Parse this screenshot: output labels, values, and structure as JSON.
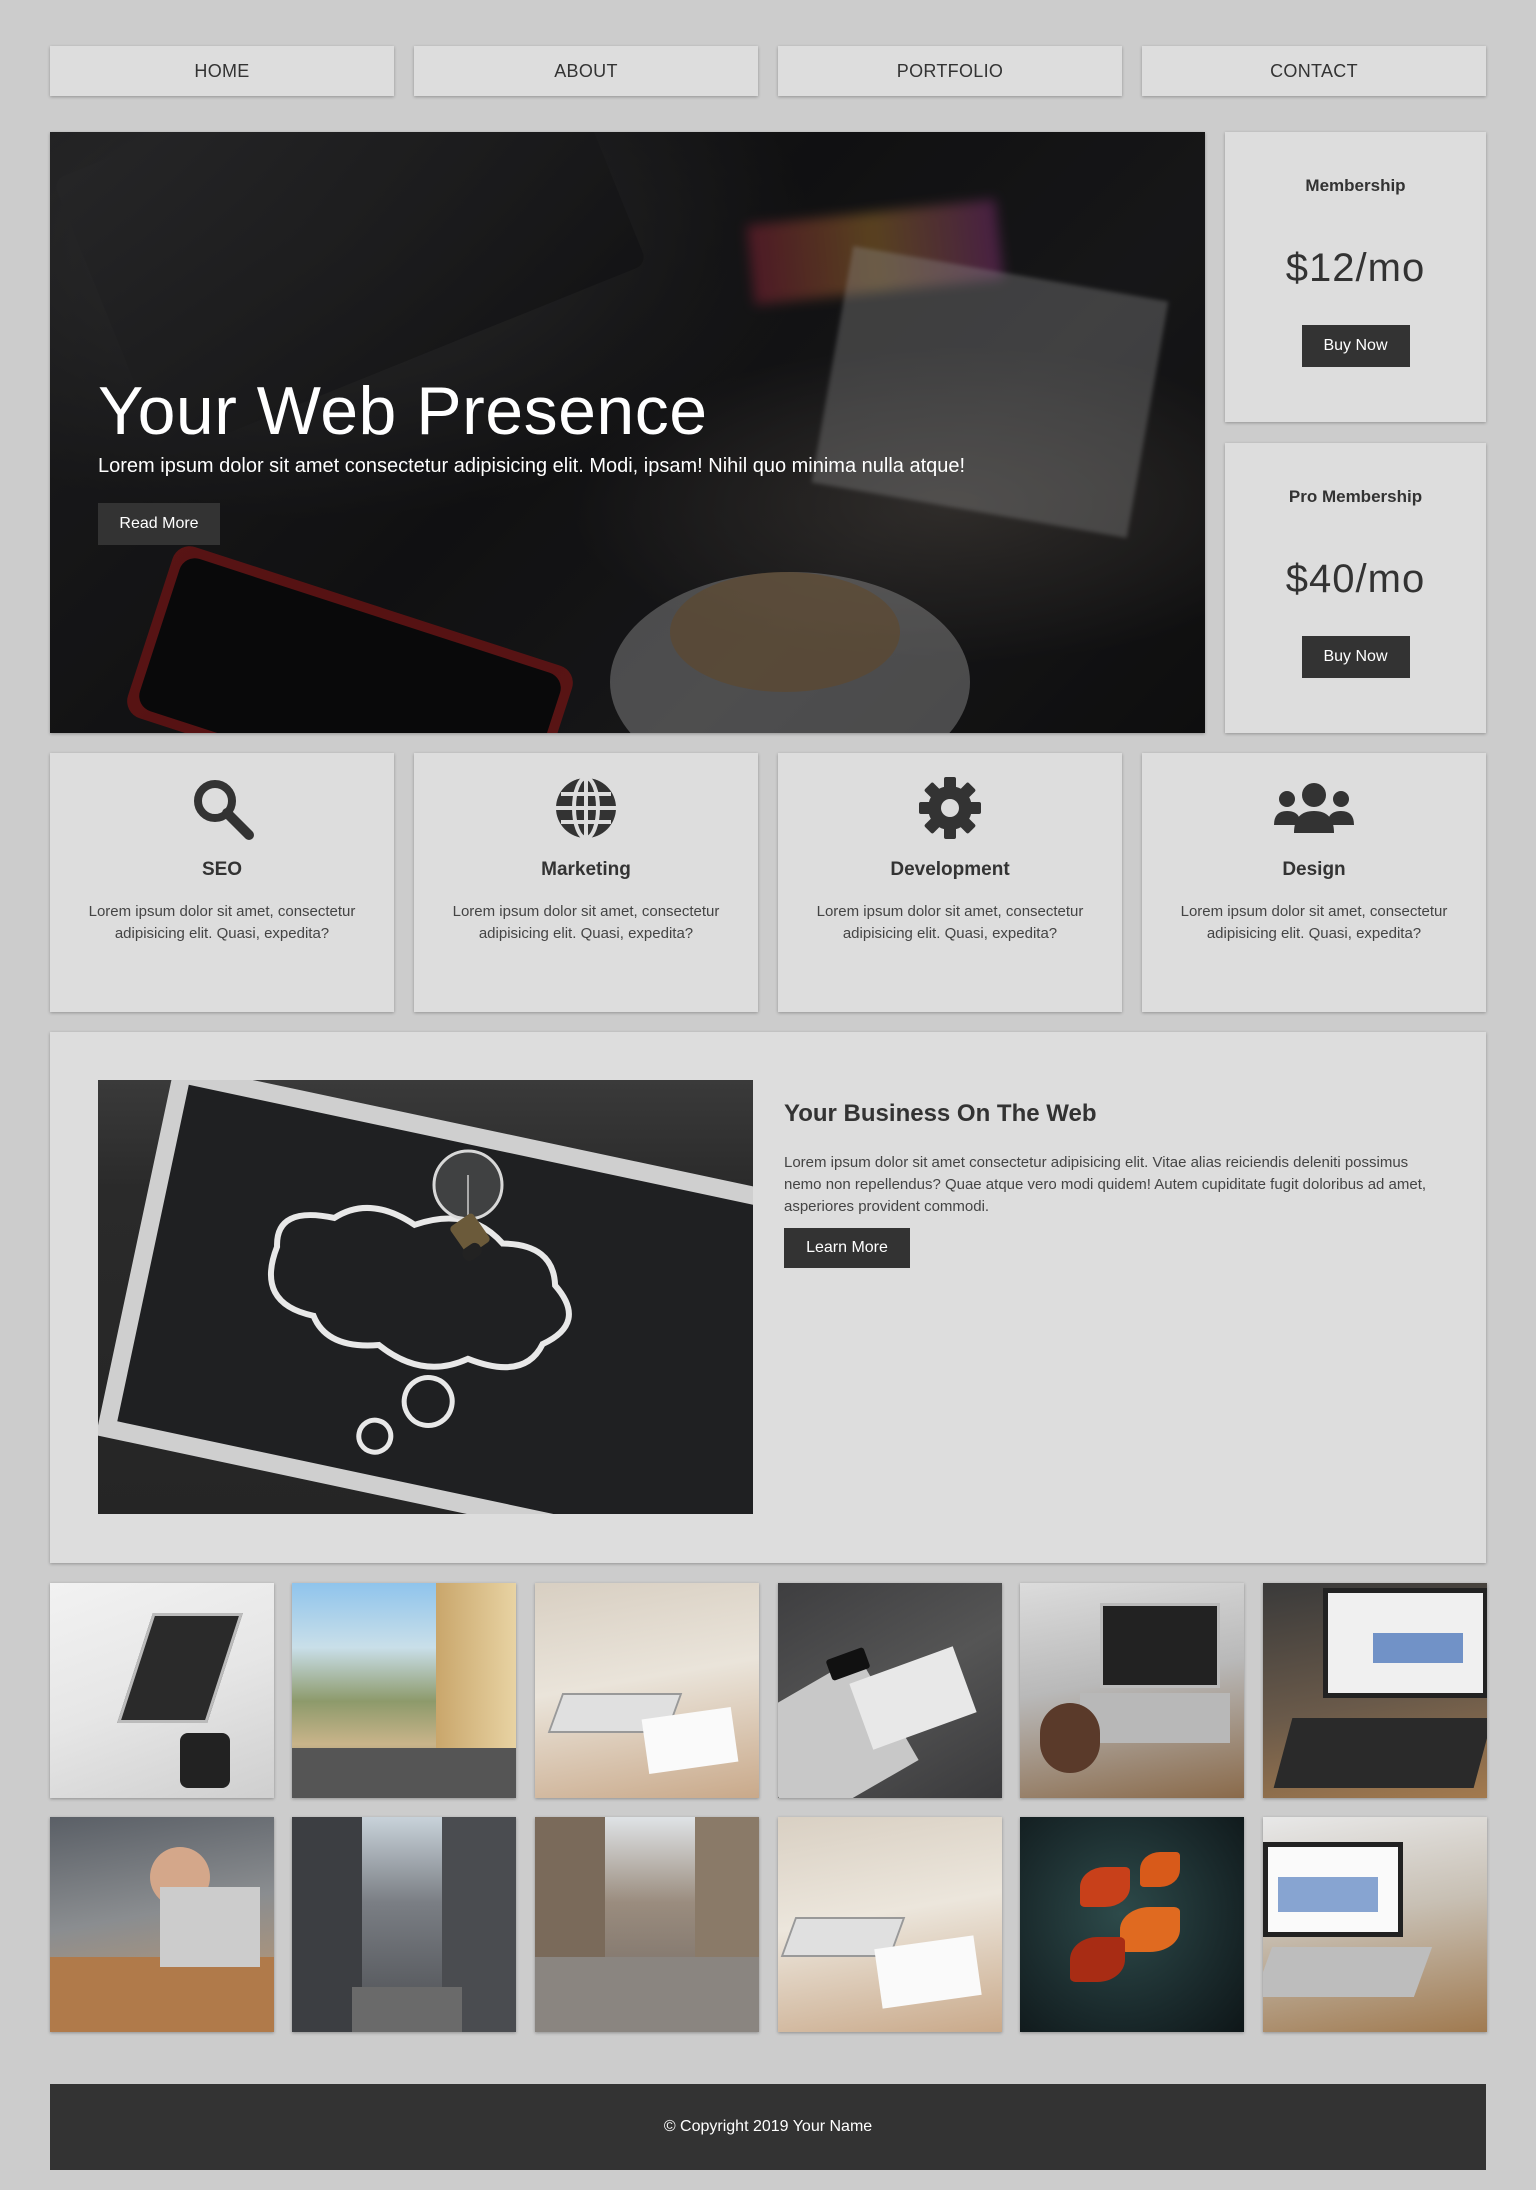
{
  "nav": {
    "items": [
      {
        "label": "HOME"
      },
      {
        "label": "ABOUT"
      },
      {
        "label": "PORTFOLIO"
      },
      {
        "label": "CONTACT"
      }
    ]
  },
  "hero": {
    "title": "Your Web Presence",
    "text": "Lorem ipsum dolor sit amet consectetur adipisicing elit. Modi, ipsam! Nihil quo minima nulla atque!",
    "button_label": "Read More"
  },
  "pricing": [
    {
      "name": "Membership",
      "price": "$12/mo",
      "button_label": "Buy Now"
    },
    {
      "name": "Pro Membership",
      "price": "$40/mo",
      "button_label": "Buy Now"
    }
  ],
  "services": [
    {
      "icon": "search-icon",
      "title": "SEO",
      "text": "Lorem ipsum dolor sit amet, consectetur adipisicing elit. Quasi, expedita?"
    },
    {
      "icon": "globe-icon",
      "title": "Marketing",
      "text": "Lorem ipsum dolor sit amet, consectetur adipisicing elit. Quasi, expedita?"
    },
    {
      "icon": "gear-icon",
      "title": "Development",
      "text": "Lorem ipsum dolor sit amet, consectetur adipisicing elit. Quasi, expedita?"
    },
    {
      "icon": "users-icon",
      "title": "Design",
      "text": "Lorem ipsum dolor sit amet, consectetur adipisicing elit. Quasi, expedita?"
    }
  ],
  "business": {
    "heading": "Your Business On The Web",
    "text": "Lorem ipsum dolor sit amet consectetur adipisicing elit. Vitae alias reiciendis deleniti possimus nemo non repellendus? Quae atque vero modi quidem! Autem cupiditate fugit doloribus ad amet, asperiores provident commodi.",
    "button_label": "Learn More"
  },
  "gallery": [
    {
      "subject": "laptop and camera lens on white desk"
    },
    {
      "subject": "city street with colorful buildings"
    },
    {
      "subject": "person typing on laptop at desk"
    },
    {
      "subject": "laptop, phone and notebook on dark desk"
    },
    {
      "subject": "hands holding phone and coffee by laptop"
    },
    {
      "subject": "hands typing on laptop showing charts"
    },
    {
      "subject": "people in office meeting"
    },
    {
      "subject": "city street with tall buildings"
    },
    {
      "subject": "old town street"
    },
    {
      "subject": "person writing near laptop"
    },
    {
      "subject": "red autumn leaves"
    },
    {
      "subject": "laptop with analytics dashboard"
    }
  ],
  "footer": {
    "text": "© Copyright 2019 Your Name"
  },
  "colors": {
    "page_background": "#cccccc",
    "card_background": "#dddddd",
    "dark": "#333333",
    "text": "#333333"
  }
}
